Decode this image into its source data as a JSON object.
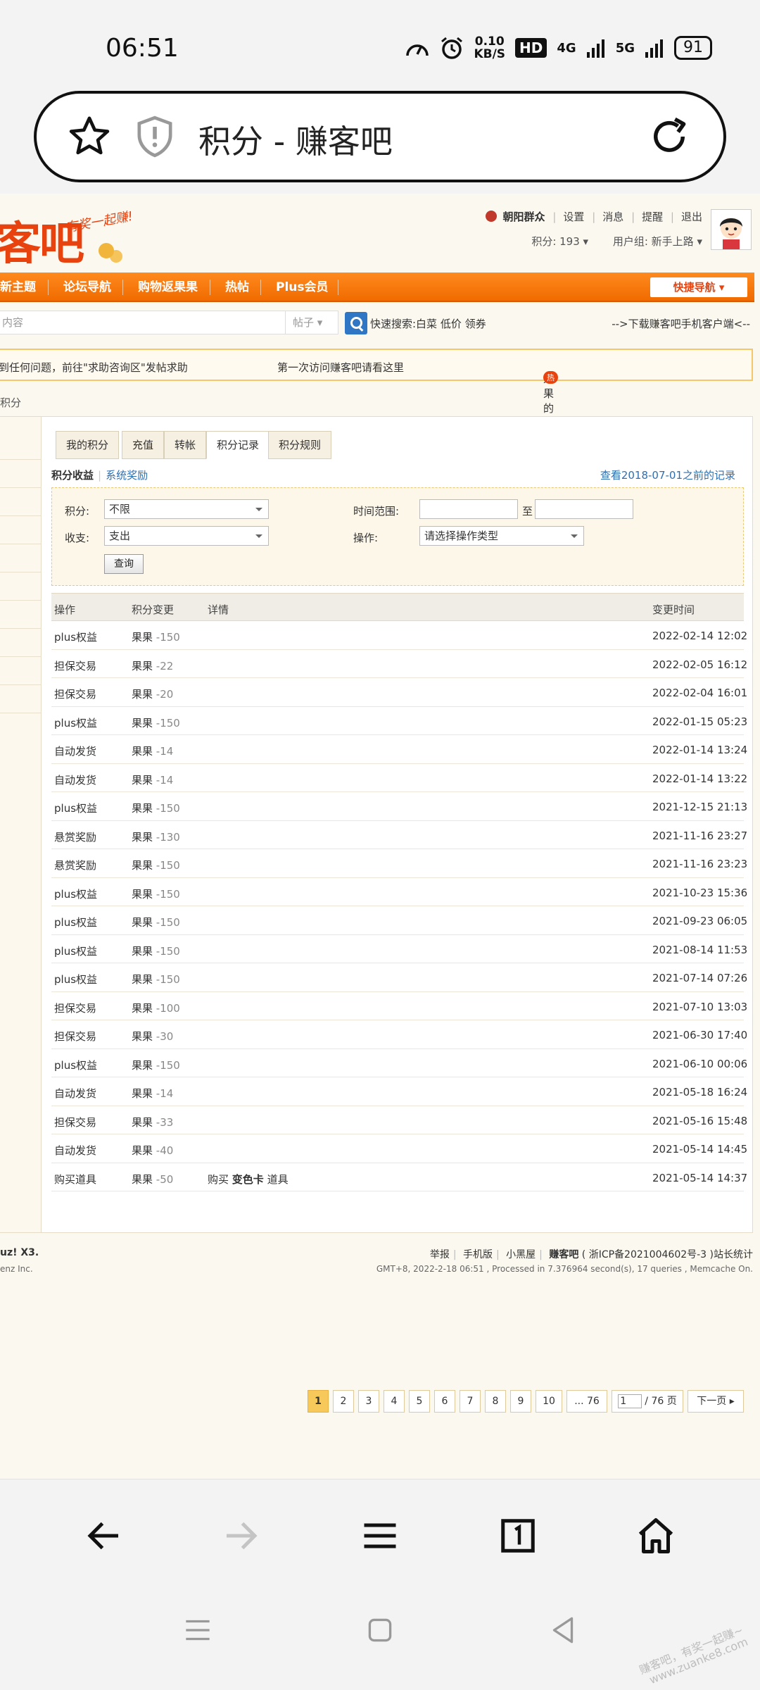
{
  "status_bar": {
    "time": "06:51",
    "speed_value": "0.10",
    "speed_unit": "KB/S",
    "hd": "HD",
    "net1": "4G",
    "net2": "5G",
    "battery": "91"
  },
  "browser": {
    "page_title": "积分 - 赚客吧"
  },
  "site": {
    "logo_text": "客吧",
    "slogan": "有奖一起赚!",
    "user": {
      "username": "朝阳群众",
      "links": [
        "设置",
        "消息",
        "提醒",
        "退出"
      ],
      "points_label": "积分: 193",
      "group_label": "用户组: 新手上路"
    },
    "nav": {
      "items": [
        "新主题",
        "论坛导航",
        "购物返果果",
        "热帖",
        "Plus会员"
      ],
      "quick_nav": "快捷导航"
    },
    "search": {
      "placeholder": "内容",
      "type": "帖子",
      "quick_search": "快速搜索:白菜 低价 领券",
      "download_link": "-->下载赚客吧手机客户端<--"
    },
    "notices": {
      "n1": "到任何问题，前往\"求助咨询区\"发帖求助",
      "n2": "第一次访问赚客吧请看这里",
      "n3": "果果的主要用途和赚取方法",
      "hot": "热"
    },
    "breadcrumb": "积分"
  },
  "credits": {
    "tabs": [
      "我的积分",
      "充值",
      "转帐",
      "积分记录",
      "积分规则"
    ],
    "active_tab": "积分记录",
    "subtabs": {
      "active": "积分收益",
      "other": "系统奖励"
    },
    "history_link": "查看2018-07-01之前的记录",
    "filter": {
      "credit_label": "积分:",
      "credit_value": "不限",
      "range_label": "时间范围:",
      "range_to": "至",
      "inout_label": "收支:",
      "inout_value": "支出",
      "op_label": "操作:",
      "op_value": "请选择操作类型",
      "query_button": "查询"
    },
    "table": {
      "headers": [
        "操作",
        "积分变更",
        "详情",
        "变更时间"
      ],
      "rows": [
        {
          "op": "plus权益",
          "unit": "果果",
          "change": "-150",
          "detail": "",
          "detail_item": "",
          "detail_suffix": "",
          "time": "2022-02-14 12:02"
        },
        {
          "op": "担保交易",
          "unit": "果果",
          "change": "-22",
          "detail": "",
          "detail_item": "",
          "detail_suffix": "",
          "time": "2022-02-05 16:12"
        },
        {
          "op": "担保交易",
          "unit": "果果",
          "change": "-20",
          "detail": "",
          "detail_item": "",
          "detail_suffix": "",
          "time": "2022-02-04 16:01"
        },
        {
          "op": "plus权益",
          "unit": "果果",
          "change": "-150",
          "detail": "",
          "detail_item": "",
          "detail_suffix": "",
          "time": "2022-01-15 05:23"
        },
        {
          "op": "自动发货",
          "unit": "果果",
          "change": "-14",
          "detail": "",
          "detail_item": "",
          "detail_suffix": "",
          "time": "2022-01-14 13:24"
        },
        {
          "op": "自动发货",
          "unit": "果果",
          "change": "-14",
          "detail": "",
          "detail_item": "",
          "detail_suffix": "",
          "time": "2022-01-14 13:22"
        },
        {
          "op": "plus权益",
          "unit": "果果",
          "change": "-150",
          "detail": "",
          "detail_item": "",
          "detail_suffix": "",
          "time": "2021-12-15 21:13"
        },
        {
          "op": "悬赏奖励",
          "unit": "果果",
          "change": "-130",
          "detail": "",
          "detail_item": "",
          "detail_suffix": "",
          "time": "2021-11-16 23:27"
        },
        {
          "op": "悬赏奖励",
          "unit": "果果",
          "change": "-150",
          "detail": "",
          "detail_item": "",
          "detail_suffix": "",
          "time": "2021-11-16 23:23"
        },
        {
          "op": "plus权益",
          "unit": "果果",
          "change": "-150",
          "detail": "",
          "detail_item": "",
          "detail_suffix": "",
          "time": "2021-10-23 15:36"
        },
        {
          "op": "plus权益",
          "unit": "果果",
          "change": "-150",
          "detail": "",
          "detail_item": "",
          "detail_suffix": "",
          "time": "2021-09-23 06:05"
        },
        {
          "op": "plus权益",
          "unit": "果果",
          "change": "-150",
          "detail": "",
          "detail_item": "",
          "detail_suffix": "",
          "time": "2021-08-14 11:53"
        },
        {
          "op": "plus权益",
          "unit": "果果",
          "change": "-150",
          "detail": "",
          "detail_item": "",
          "detail_suffix": "",
          "time": "2021-07-14 07:26"
        },
        {
          "op": "担保交易",
          "unit": "果果",
          "change": "-100",
          "detail": "",
          "detail_item": "",
          "detail_suffix": "",
          "time": "2021-07-10 13:03"
        },
        {
          "op": "担保交易",
          "unit": "果果",
          "change": "-30",
          "detail": "",
          "detail_item": "",
          "detail_suffix": "",
          "time": "2021-06-30 17:40"
        },
        {
          "op": "plus权益",
          "unit": "果果",
          "change": "-150",
          "detail": "",
          "detail_item": "",
          "detail_suffix": "",
          "time": "2021-06-10 00:06"
        },
        {
          "op": "自动发货",
          "unit": "果果",
          "change": "-14",
          "detail": "",
          "detail_item": "",
          "detail_suffix": "",
          "time": "2021-05-18 16:24"
        },
        {
          "op": "担保交易",
          "unit": "果果",
          "change": "-33",
          "detail": "",
          "detail_item": "",
          "detail_suffix": "",
          "time": "2021-05-16 15:48"
        },
        {
          "op": "自动发货",
          "unit": "果果",
          "change": "-40",
          "detail": "",
          "detail_item": "",
          "detail_suffix": "",
          "time": "2021-05-14 14:45"
        },
        {
          "op": "购买道具",
          "unit": "果果",
          "change": "-50",
          "detail": "购买",
          "detail_item": "变色卡",
          "detail_suffix": "道具",
          "time": "2021-05-14 14:37"
        }
      ]
    },
    "pagination": {
      "pages": [
        "1",
        "2",
        "3",
        "4",
        "5",
        "6",
        "7",
        "8",
        "9",
        "10",
        "... 76"
      ],
      "current": "1",
      "input_value": "1",
      "total": "/ 76 页",
      "next": "下一页"
    }
  },
  "footer": {
    "powered_line1": "uz! X3.",
    "powered_line2": "enz Inc.",
    "links": [
      "举报",
      "手机版",
      "小黑屋"
    ],
    "site_name": "赚客吧",
    "icp": "( 浙ICP备2021004602号-3 )",
    "stats_link": "站长统计",
    "stats": "GMT+8, 2022-2-18 06:51 , Processed in 7.376964 second(s), 17 queries , Memcache On."
  },
  "watermark": {
    "line1": "赚客吧，有奖一起赚~",
    "line2": "www.zuanke8.com"
  }
}
